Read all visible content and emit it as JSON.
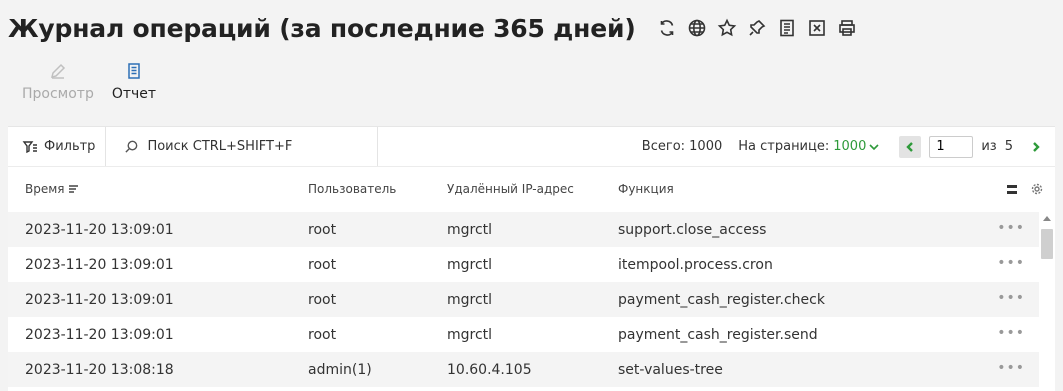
{
  "header": {
    "title": "Журнал операций (за последние 365 дней)",
    "icons": [
      "refresh-icon",
      "globe-icon",
      "star-icon",
      "pin-icon",
      "document-icon",
      "excel-icon",
      "print-icon"
    ]
  },
  "actions": {
    "view_label": "Просмотр",
    "report_label": "Отчет"
  },
  "toolbar": {
    "filter_label": "Фильтр",
    "search_placeholder": "Поиск CTRL+SHIFT+F",
    "total_label": "Всего: 1000",
    "per_page_label": "На странице:",
    "per_page_value": "1000",
    "current_page": "1",
    "of_label": "из",
    "page_count": "5"
  },
  "table": {
    "columns": [
      "Время",
      "Пользователь",
      "Удалённый IP-адрес",
      "Функция"
    ],
    "rows": [
      {
        "time": "2023-11-20 13:09:01",
        "user": "root",
        "ip": "mgrctl",
        "func": "support.close_access"
      },
      {
        "time": "2023-11-20 13:09:01",
        "user": "root",
        "ip": "mgrctl",
        "func": "itempool.process.cron"
      },
      {
        "time": "2023-11-20 13:09:01",
        "user": "root",
        "ip": "mgrctl",
        "func": "payment_cash_register.check"
      },
      {
        "time": "2023-11-20 13:09:01",
        "user": "root",
        "ip": "mgrctl",
        "func": "payment_cash_register.send"
      },
      {
        "time": "2023-11-20 13:08:18",
        "user": "admin(1)",
        "ip": "10.60.4.105",
        "func": "set-values-tree"
      }
    ],
    "row_menu": "•••"
  },
  "colors": {
    "accent_green": "#2e9a3a",
    "accent_blue": "#2d6fb6"
  }
}
